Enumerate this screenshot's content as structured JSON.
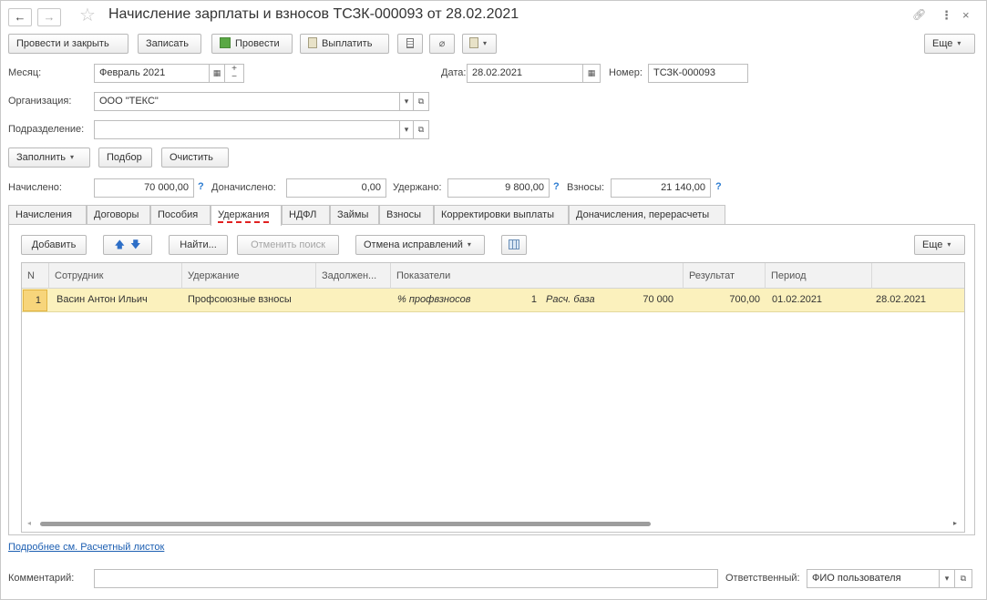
{
  "window": {
    "title": "Начисление зарплаты и взносов ТСЗК-000093 от 28.02.2021",
    "back_glyph": "←",
    "forward_glyph": "→",
    "star_glyph": "☆",
    "link_glyph": "🔗",
    "menu_glyph": "⋮",
    "close_glyph": "×"
  },
  "toolbar": {
    "post_close": "Провести и закрыть",
    "save": "Записать",
    "post": "Провести",
    "pay": "Выплатить",
    "more": "Еще"
  },
  "form": {
    "month_label": "Месяц:",
    "month_value": "Февраль 2021",
    "date_label": "Дата:",
    "date_value": "28.02.2021",
    "number_label": "Номер:",
    "number_value": "ТСЗК-000093",
    "org_label": "Организация:",
    "org_value": "ООО \"ТЕКС\"",
    "dept_label": "Подразделение:",
    "dept_value": ""
  },
  "fill_toolbar": {
    "fill": "Заполнить",
    "pick": "Подбор",
    "clear": "Очистить"
  },
  "totals": {
    "accrued_label": "Начислено:",
    "accrued_value": "70 000,00",
    "additional_label": "Доначислено:",
    "additional_value": "0,00",
    "withheld_label": "Удержано:",
    "withheld_value": "9 800,00",
    "contrib_label": "Взносы:",
    "contrib_value": "21 140,00",
    "help": "?"
  },
  "tabs": [
    "Начисления",
    "Договоры",
    "Пособия",
    "Удержания",
    "НДФЛ",
    "Займы",
    "Взносы",
    "Корректировки выплаты",
    "Доначисления, перерасчеты"
  ],
  "table_toolbar": {
    "add": "Добавить",
    "find": "Найти...",
    "cancel_search": "Отменить поиск",
    "corrections": "Отмена исправлений",
    "more": "Еще"
  },
  "table": {
    "headers": [
      "N",
      "Сотрудник",
      "Удержание",
      "Задолжен...",
      "Показатели",
      "Результат",
      "Период"
    ],
    "row": {
      "n": "1",
      "employee": "Васин Антон Ильич",
      "deduction": "Профсоюзные взносы",
      "debt": "",
      "ind1_name": "% профвзносов",
      "ind1_value": "1",
      "ind2_name": "Расч. база",
      "ind2_value": "70 000",
      "result": "700,00",
      "period_start": "01.02.2021",
      "period_end": "28.02.2021"
    }
  },
  "details_link": "Подробнее см. Расчетный листок",
  "footer": {
    "comment_label": "Комментарий:",
    "comment_value": "",
    "responsible_label": "Ответственный:",
    "responsible_value": "ФИО пользователя"
  }
}
